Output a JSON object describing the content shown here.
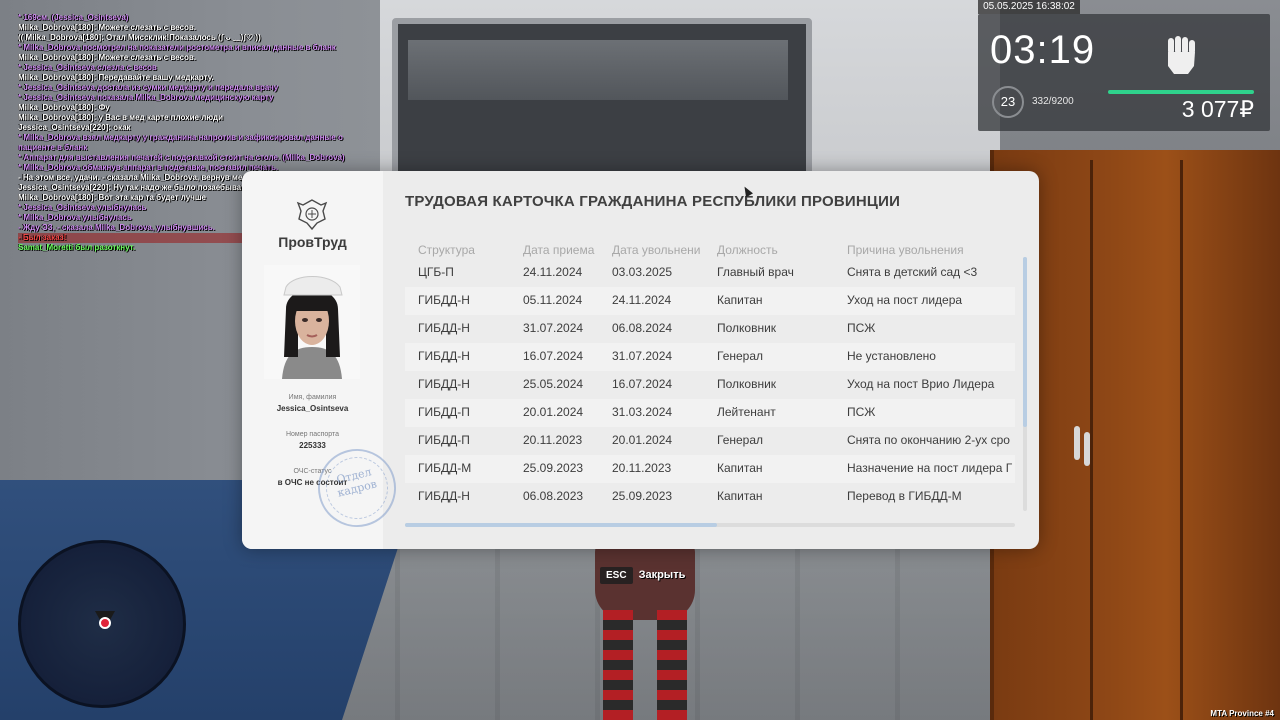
{
  "chat": [
    {
      "text": "* 169см. (Jessica_Osintseva)",
      "style": "c-me"
    },
    {
      "text": "Milka_Dobrova[180]: Можете слезать с весов.",
      "style": "c-white",
      "tag": "Milka_Dobrova[180]"
    },
    {
      "text": "(( Milka_Dobrova[180]: Отал Миссклик!Показалось (ʃ ᴗ ﹏)ʃ♡ ))",
      "style": "c-white"
    },
    {
      "text": "* Milka_Dobrova посмотрел на показатели ростометра и вписал данные в бланк",
      "style": "c-me"
    },
    {
      "text": "Milka_Dobrova[180]: Можете слезать с весов.",
      "style": "c-white",
      "tag": "Milka_Dobrova[180]"
    },
    {
      "text": "* Jessica_Osintseva слезла с весов",
      "style": "c-me"
    },
    {
      "text": "Milka_Dobrova[180]: Передавайте вашу медкарту.",
      "style": "c-white",
      "tag": "Milka_Dobrova[180]"
    },
    {
      "text": "* Jessica_Osintseva достала из сумки медкарту и передала врачу",
      "style": "c-me"
    },
    {
      "text": "* Jessica_Osintseva показала Milka_Dobrova медицинскую карту",
      "style": "c-me"
    },
    {
      "text": "Milka_Dobrova[180]: Фу",
      "style": "c-white",
      "tag": "Milka_Dobrova[180]"
    },
    {
      "text": "Milka_Dobrova[180]: у Вас в мед карте плохие люди",
      "style": "c-white",
      "tag": "Milka_Dobrova[180]"
    },
    {
      "text": "Jessica_Osintseva[220]: окак",
      "style": "c-white"
    },
    {
      "text": "* Milka_Dobrova взял медкарту у гражданина напротив и зафиксировал данные о пациенте в бланк",
      "style": "c-me",
      "wrap": true
    },
    {
      "text": "* Аппарат для выставления печатей с подставкой стоит на столе. (Milka_Dobrova)",
      "style": "c-me",
      "wrap": true
    },
    {
      "text": "* Milka_Dobrova обмакнув аппарат в подставке, поставил печать.",
      "style": "c-me"
    },
    {
      "text": "- На этом все, удачи. - сказала Milka_Dobrova, вернув мед.карту владельцу.",
      "style": "c-white"
    },
    {
      "text": "Jessica_Osintseva[220]: Ну так надо же было позаебывать его с медкартой",
      "style": "c-white"
    },
    {
      "text": "Milka_Dobrova[180]: Вот эта кар та будет лучше",
      "style": "c-white",
      "tag": "Milka_Dobrova[180]"
    },
    {
      "text": "* Jessica_Osintseva улыбнулась",
      "style": "c-me"
    },
    {
      "text": "* Milka_Dobrova улыбнулась",
      "style": "c-me"
    },
    {
      "text": "- Жду ЭЗ, - сказала Milka_Dobrova, улыбнувшись.",
      "style": "c-me"
    },
    {
      "text": "- Был заказ!",
      "style": "c-red"
    },
    {
      "text": "Samat_Moretti был разоткнут.",
      "style": "c-green"
    }
  ],
  "hud": {
    "datetime": "05.05.2025 16:38:02",
    "clock": "03:19",
    "level": "23",
    "exp": "332/9200",
    "money": "3 077₽",
    "fist_icon": "fist-icon"
  },
  "dialog": {
    "ministry": "ПровТруд",
    "title": "ТРУДОВАЯ КАРТОЧКА ГРАЖДАНИНА РЕСПУБЛИКИ ПРОВИНЦИИ",
    "name_label": "Имя, фамилия",
    "name_value": "Jessica_Osintseva",
    "passport_label": "Номер паспорта",
    "passport_value": "225333",
    "ochs_label": "ОЧС-статус",
    "ochs_value": "в ОЧС не состоит",
    "stamp_text": "Отдел кадров",
    "columns": [
      "Структура",
      "Дата приема",
      "Дата увольнени",
      "Должность",
      "Причина увольнения"
    ],
    "rows": [
      [
        "ЦГБ-П",
        "24.11.2024",
        "03.03.2025",
        "Главный врач",
        "Снята в детский сад <3"
      ],
      [
        "ГИБДД-Н",
        "05.11.2024",
        "24.11.2024",
        "Капитан",
        "Уход на пост лидера"
      ],
      [
        "ГИБДД-Н",
        "31.07.2024",
        "06.08.2024",
        "Полковник",
        "ПСЖ"
      ],
      [
        "ГИБДД-Н",
        "16.07.2024",
        "31.07.2024",
        "Генерал",
        "Не установлено"
      ],
      [
        "ГИБДД-Н",
        "25.05.2024",
        "16.07.2024",
        "Полковник",
        "Уход на пост Врио Лидера"
      ],
      [
        "ГИБДД-П",
        "20.01.2024",
        "31.03.2024",
        "Лейтенант",
        "ПСЖ"
      ],
      [
        "ГИБДД-П",
        "20.11.2023",
        "20.01.2024",
        "Генерал",
        "Снята по окончанию 2-ух сро"
      ],
      [
        "ГИБДД-М",
        "25.09.2023",
        "20.11.2023",
        "Капитан",
        "Назначение на пост лидера Г"
      ],
      [
        "ГИБДД-Н",
        "06.08.2023",
        "25.09.2023",
        "Капитан",
        "Перевод в ГИБДД-М"
      ]
    ]
  },
  "close_hint": {
    "key": "ESC",
    "label": "Закрыть"
  },
  "server": "MTA Province #4"
}
